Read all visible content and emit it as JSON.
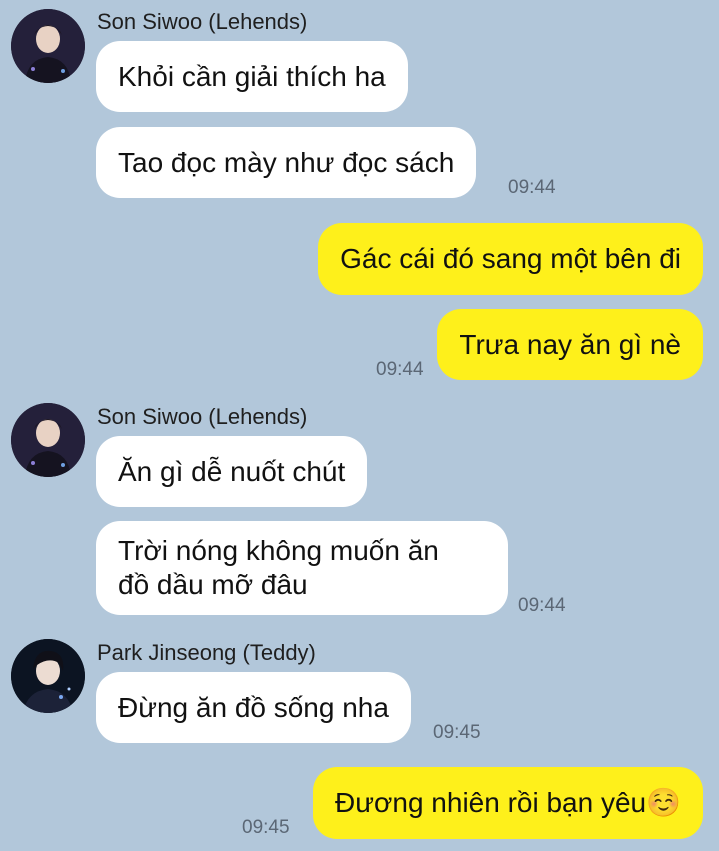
{
  "colors": {
    "background": "#b2c7da",
    "incoming_bubble": "#ffffff",
    "outgoing_bubble": "#fef01b",
    "timestamp": "#5b6775"
  },
  "groups": [
    {
      "sender": "Son Siwoo (Lehends)",
      "avatar": "user-avatar-photo",
      "messages": [
        {
          "text": "Khỏi cần giải thích ha"
        },
        {
          "text": "Tao đọc mày như đọc sách"
        }
      ],
      "time": "09:44"
    },
    {
      "outgoing": true,
      "messages": [
        {
          "text": "Gác cái đó sang một bên đi"
        },
        {
          "text": "Trưa nay ăn gì nè"
        }
      ],
      "time": "09:44"
    },
    {
      "sender": "Son Siwoo (Lehends)",
      "avatar": "user-avatar-photo",
      "messages": [
        {
          "text": "Ăn gì dễ nuốt chút"
        },
        {
          "lines": [
            "Trời nóng không muốn ăn",
            "đồ dầu mỡ đâu"
          ]
        }
      ],
      "time": "09:44"
    },
    {
      "sender": "Park Jinseong (Teddy)",
      "avatar": "user-avatar-photo",
      "messages": [
        {
          "text": "Đừng ăn đồ sống nha"
        }
      ],
      "time": "09:45"
    },
    {
      "outgoing": true,
      "messages": [
        {
          "text": "Đương nhiên rồi bạn yêu",
          "emoji": "☺️"
        }
      ],
      "time": "09:45"
    }
  ]
}
